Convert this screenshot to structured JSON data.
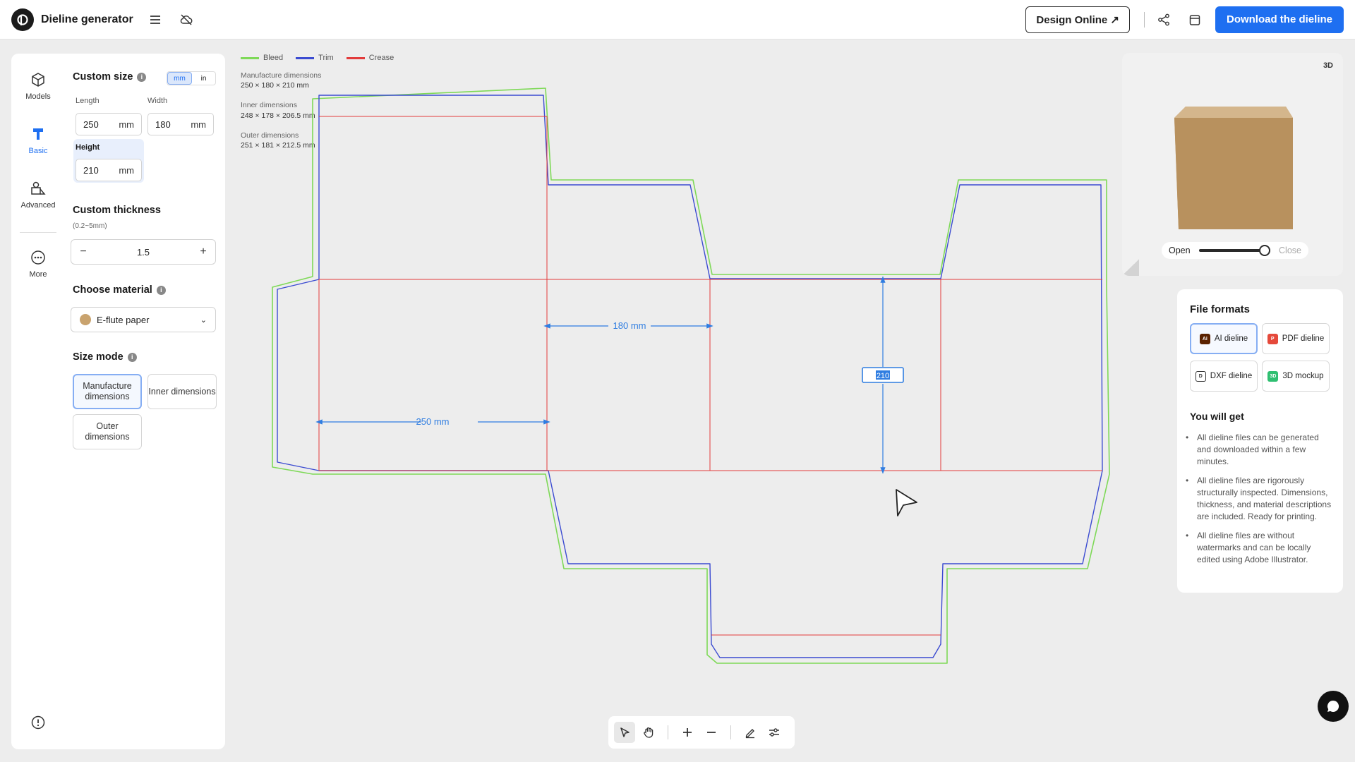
{
  "app": {
    "title": "Dieline generator"
  },
  "header": {
    "design_online": "Design Online ↗",
    "download": "Download the dieline"
  },
  "rail": [
    {
      "label": "Models",
      "icon": "cube-icon"
    },
    {
      "label": "Basic",
      "icon": "ruler-icon"
    },
    {
      "label": "Advanced",
      "icon": "shapes-icon"
    },
    {
      "label": "More",
      "icon": "more-icon"
    }
  ],
  "size": {
    "title": "Custom size",
    "units": [
      "mm",
      "in"
    ],
    "selected_unit": "mm",
    "length_label": "Length",
    "length_value": "250",
    "length_unit": "mm",
    "width_label": "Width",
    "width_value": "180",
    "width_unit": "mm",
    "height_label": "Height",
    "height_value": "210",
    "height_unit": "mm"
  },
  "thickness": {
    "title": "Custom thickness",
    "range": "(0.2~5mm)",
    "value": "1.5",
    "minus": "−",
    "plus": "+"
  },
  "material": {
    "title": "Choose material",
    "value": "E-flute paper",
    "chevron": "⌄",
    "swatch_color": "#c9a36e"
  },
  "size_mode": {
    "title": "Size mode",
    "options": [
      "Manufacture dimensions",
      "Inner dimensions",
      "Outer dimensions"
    ],
    "selected": "Manufacture dimensions"
  },
  "legend": [
    {
      "label": "Bleed",
      "color": "#7ed957"
    },
    {
      "label": "Trim",
      "color": "#3b4bd1"
    },
    {
      "label": "Crease",
      "color": "#e23b3b"
    }
  ],
  "dimensions": [
    {
      "label": "Manufacture dimensions",
      "value": "250 × 180 × 210 mm"
    },
    {
      "label": "Inner dimensions",
      "value": "248 × 178 × 206.5 mm"
    },
    {
      "label": "Outer dimensions",
      "value": "251 × 181 × 212.5 mm"
    }
  ],
  "canvas": {
    "dim_length": "250 mm",
    "dim_width": "180 mm",
    "dim_height": "210"
  },
  "preview": {
    "badge": "3D",
    "open": "Open",
    "close": "Close",
    "open_state": 1.0
  },
  "files": {
    "title": "File formats",
    "formats": [
      {
        "label": "AI dieline",
        "icon": "ai-file-icon",
        "color": "#8a3a00"
      },
      {
        "label": "PDF dieline",
        "icon": "pdf-file-icon",
        "color": "#e5493b"
      },
      {
        "label": "DXF dieline",
        "icon": "dxf-file-icon",
        "color": "#333333"
      },
      {
        "label": "3D mockup",
        "icon": "mockup-icon",
        "color": "#2fbf71"
      }
    ],
    "selected": "AI dieline",
    "get_title": "You will get",
    "benefits": [
      "All dieline files can be generated and downloaded within a few minutes.",
      "All dieline files are rigorously structurally inspected. Dimensions, thickness, and material descriptions are included. Ready for printing.",
      "All dieline files are without watermarks and can be locally edited using Adobe Illustrator."
    ]
  },
  "colors": {
    "accent": "#1e6ff1",
    "bleed": "#7ed957",
    "trim": "#3b4bd1",
    "crease": "#e23b3b",
    "dim": "#2f7de1"
  }
}
